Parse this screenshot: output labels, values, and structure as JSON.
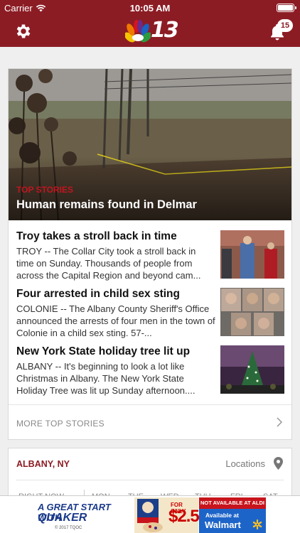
{
  "status_bar": {
    "carrier": "Carrier",
    "time": "10:05 AM"
  },
  "nav": {
    "logo_number": "13",
    "notification_count": "15"
  },
  "top_stories": {
    "hero": {
      "kicker": "TOP STORIES",
      "title": "Human remains found in Delmar"
    },
    "items": [
      {
        "title": "Troy takes a stroll back in time",
        "summary": "TROY -- The Collar City took a stroll back in time on Sunday. Thousands of people from across the Capital Region and beyond cam..."
      },
      {
        "title": "Four arrested in child sex sting",
        "summary": "COLONIE -- The Albany County Sheriff's Office announced the arrests of four men in the town of Colonie in a child sex sting. 57-..."
      },
      {
        "title": "New York State holiday tree lit up",
        "summary": "ALBANY -- It's beginning to look a lot like Christmas in Albany. The New York State Holiday Tree was lit up Sunday afternoon...."
      }
    ],
    "more_label": "MORE TOP STORIES"
  },
  "weather": {
    "city": "ALBANY, NY",
    "locations_label": "Locations",
    "days": [
      "RIGHT NOW",
      "MON",
      "TUE",
      "WED",
      "THU",
      "FRI",
      "SAT"
    ]
  },
  "ad": {
    "line1": "A GREAT START WITH",
    "line2": "QUAKER",
    "fine_print": "© 2017 TQOC",
    "price_label": "FOR ONLY",
    "price": "$2.50",
    "banner": "NOT AVAILABLE AT ALDI",
    "available": "Available at",
    "store": "Walmart"
  },
  "colors": {
    "brand": "#8c1c24",
    "kicker": "#c0161f"
  }
}
